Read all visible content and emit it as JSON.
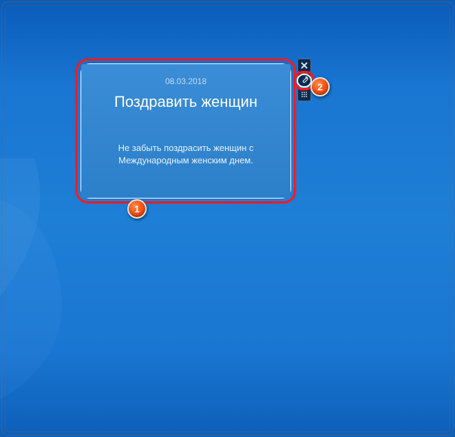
{
  "gadget": {
    "date": "08.03.2018",
    "title": "Поздравить женщин",
    "description": "Не забыть поздрасить женщин с Международным женским днем."
  },
  "callouts": {
    "marker1": "1",
    "marker2": "2"
  }
}
